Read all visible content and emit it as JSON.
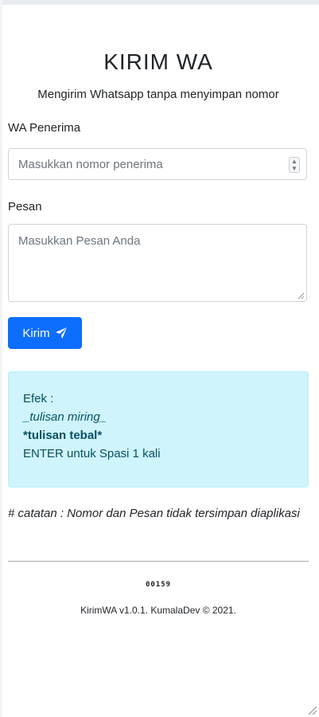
{
  "header": {
    "title": "KIRIM WA",
    "subtitle": "Mengirim Whatsapp tanpa menyimpan nomor"
  },
  "form": {
    "wa_label": "WA Penerima",
    "wa_placeholder": "Masukkan nomor penerima",
    "pesan_label": "Pesan",
    "pesan_placeholder": "Masukkan Pesan Anda",
    "submit_label": "Kirim",
    "submit_icon": "paper-plane-icon"
  },
  "info": {
    "heading": "Efek :",
    "italic_example": "_tulisan miring_",
    "bold_example": "*tulisan tebal*",
    "enter_example": "ENTER untuk Spasi 1 kali"
  },
  "note": "# catatan : Nomor dan Pesan tidak tersimpan diaplikasi",
  "footer": {
    "counter": "00159",
    "copyright": "KirimWA v1.0.1. KumalaDev © 2021."
  },
  "colors": {
    "primary": "#0d6efd",
    "alert_bg": "#cff4fc",
    "alert_text": "#055160"
  }
}
